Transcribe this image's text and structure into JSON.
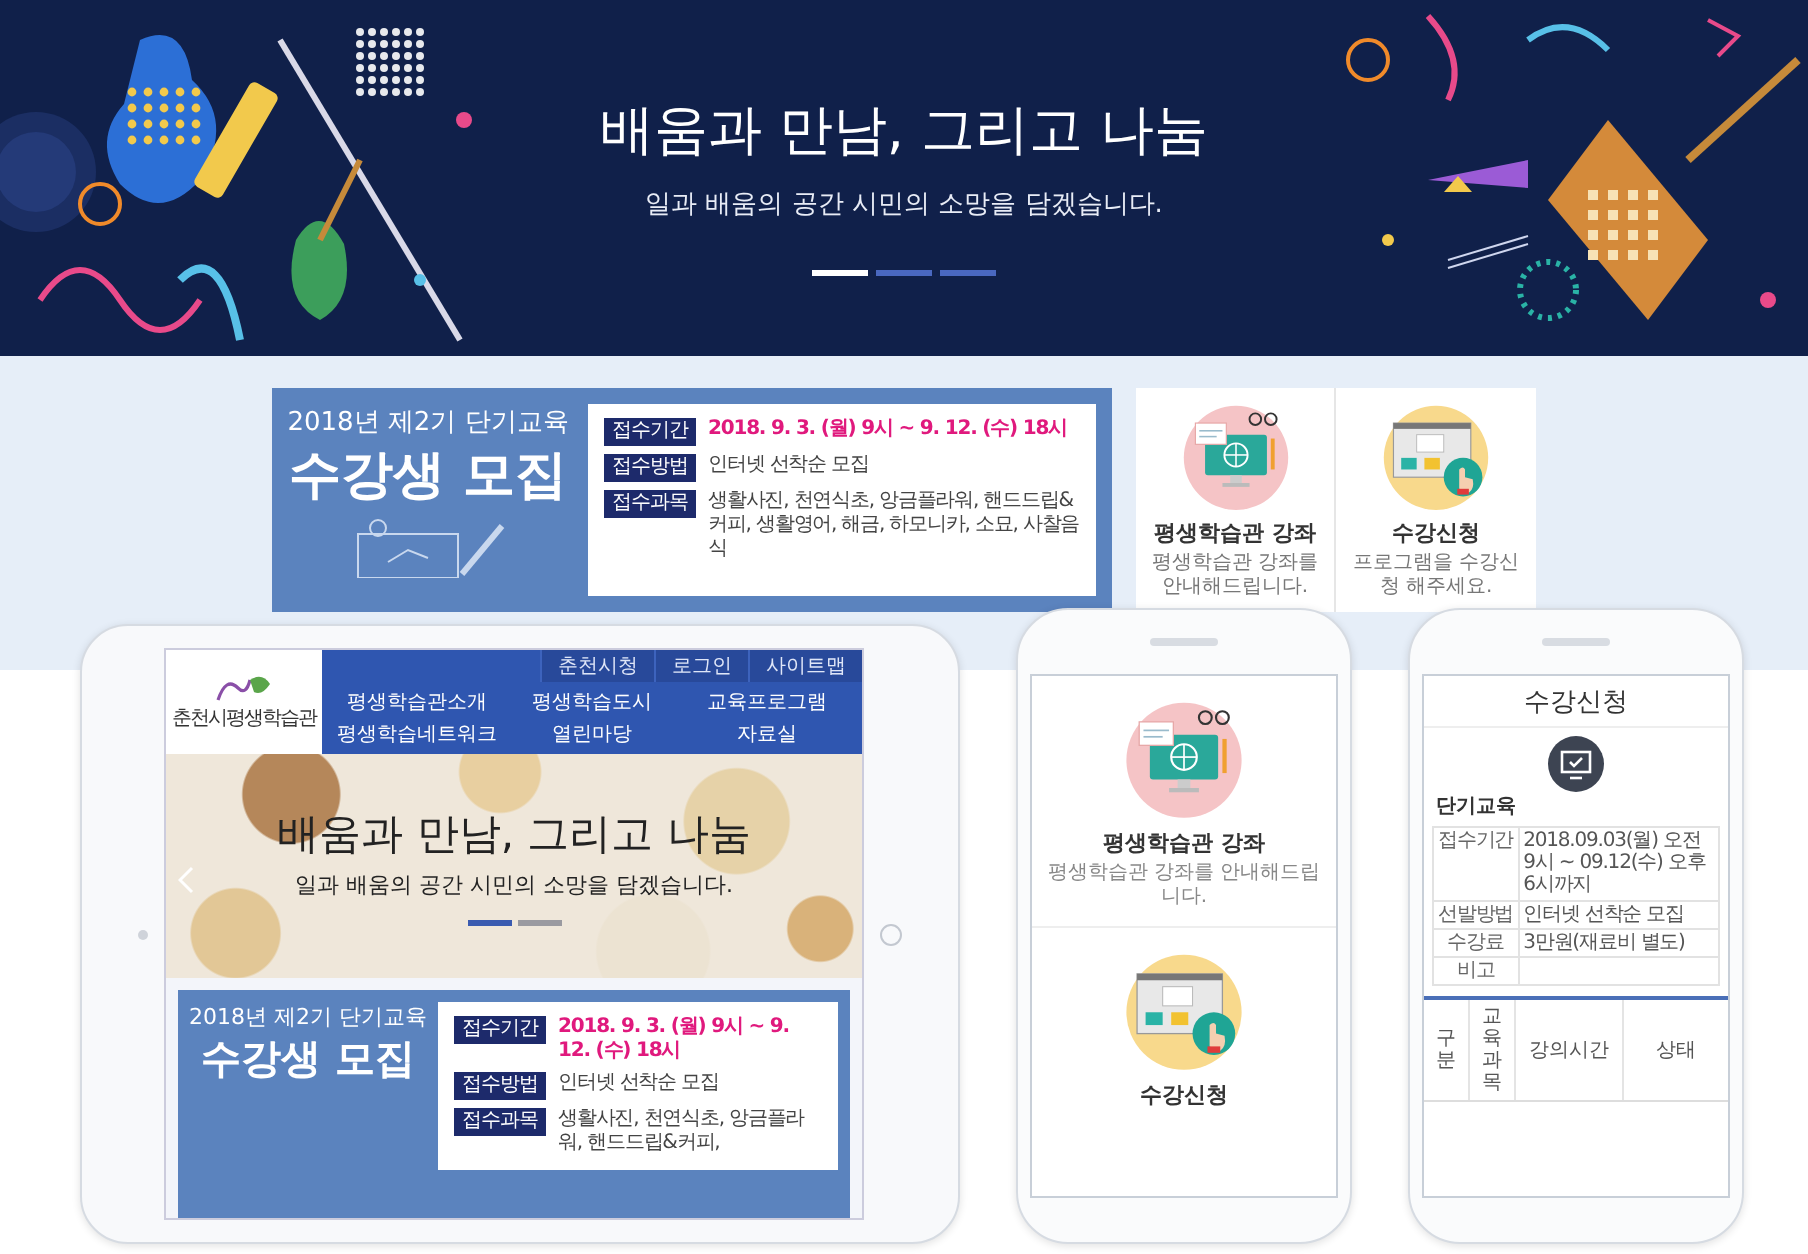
{
  "hero": {
    "title": "배움과 만남, 그리고 나눔",
    "subtitle": "일과 배움의 공간 시민의 소망을 담겠습니다.",
    "indicators": [
      {
        "selected": true
      },
      {
        "selected": false
      },
      {
        "selected": false
      }
    ]
  },
  "promo": {
    "banner": {
      "year_line": "2018년 제2기 단기교육",
      "headline": "수강생 모집",
      "rows": [
        {
          "label": "접수기간",
          "value": "2018. 9. 3. (월) 9시 ~ 9. 12. (수) 18시",
          "kind": "date"
        },
        {
          "label": "접수방법",
          "value": "인터넷 선착순 모집",
          "kind": "text"
        },
        {
          "label": "접수과목",
          "value": "생활사진, 천연식초, 앙금플라워, 핸드드립&커피, 생활영어, 해금, 하모니카, 소묘, 사찰음식",
          "kind": "text"
        }
      ]
    },
    "services": [
      {
        "title": "평생학습관 강좌",
        "description": "평생학습관 강좌를 안내해드립니다.",
        "kind": "computer"
      },
      {
        "title": "수강신청",
        "description": "프로그램을 수강신청 해주세요.",
        "kind": "browser"
      }
    ]
  },
  "tablet": {
    "logo_text": "춘천시평생학습관",
    "top_links": [
      "춘천시청",
      "로그인",
      "사이트맵"
    ],
    "nav": [
      "평생학습관소개",
      "평생학습도시",
      "교육프로그램",
      "평생학습네트워크",
      "열린마당",
      "자료실"
    ],
    "hero": {
      "title": "배움과 만남, 그리고 나눔",
      "subtitle": "일과 배움의 공간 시민의 소망을 담겠습니다.",
      "indicators": [
        {
          "selected": true
        },
        {
          "selected": false
        }
      ]
    },
    "banner": {
      "year_line": "2018년 제2기 단기교육",
      "headline": "수강생 모집",
      "rows": [
        {
          "label": "접수기간",
          "value": "2018. 9. 3. (월) 9시 ~ 9. 12. (수) 18시",
          "kind": "date"
        },
        {
          "label": "접수방법",
          "value": "인터넷 선착순 모집",
          "kind": "text"
        },
        {
          "label": "접수과목",
          "value": "생활사진, 천연식초, 앙금플라워, 핸드드립&커피,",
          "kind": "text"
        }
      ]
    }
  },
  "phone_services": [
    {
      "title": "평생학습관 강좌",
      "description": "평생학습관 강좌를 안내해드립니다.",
      "kind": "computer"
    },
    {
      "title": "수강신청",
      "kind": "browser"
    }
  ],
  "phone_apply": {
    "title": "수강신청",
    "section": "단기교육",
    "info": [
      {
        "label": "접수기간",
        "value": "2018.09.03(월) 오전 9시 ~ 09.12(수) 오후 6시까지"
      },
      {
        "label": "선발방법",
        "value": "인터넷 선착순 모집"
      },
      {
        "label": "수강료",
        "value": "3만원(재료비 별도)"
      },
      {
        "label": "비고"
      }
    ],
    "columns": [
      "구분",
      "교육과목",
      "강의시간",
      "상태"
    ]
  }
}
